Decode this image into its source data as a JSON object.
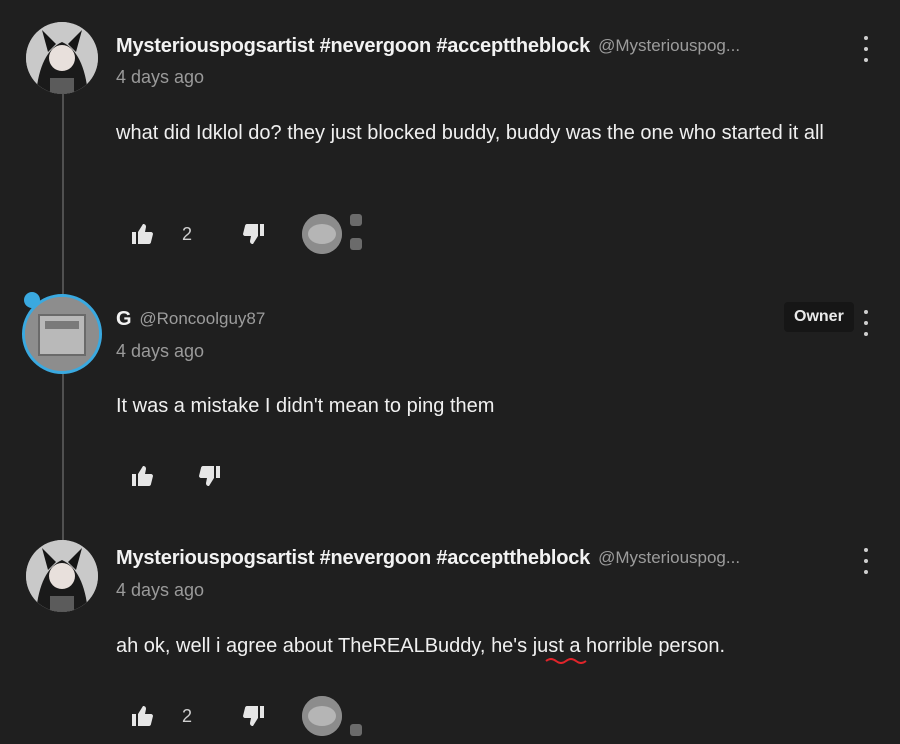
{
  "comments": [
    {
      "author": "Mysteriouspogsartist #nevergoon #accepttheblock",
      "handle": "@Mysteriouspog...",
      "timestamp": "4 days ago",
      "text": "what did Idklol do? they just blocked buddy, buddy was the one who started it all",
      "like_count": "2"
    },
    {
      "author": "G",
      "handle": "@Roncoolguy87",
      "timestamp": "4 days ago",
      "text": "It was a mistake I didn't mean to ping them",
      "owner_label": "Owner"
    },
    {
      "author": "Mysteriouspogsartist #nevergoon #accepttheblock",
      "handle": "@Mysteriouspog...",
      "timestamp": "4 days ago",
      "text_before": "ah ok, well i agree about TheREALBuddy, ",
      "text_flagged": "he's",
      "text_after": " just a horrible person.",
      "like_count": "2"
    }
  ],
  "colors": {
    "background": "#1f1f1f",
    "owner_ring": "#3aa9e0",
    "spellcheck": "#e0242a"
  },
  "icons": [
    "thumbs-up-icon",
    "thumbs-down-icon",
    "more-vertical-icon"
  ]
}
